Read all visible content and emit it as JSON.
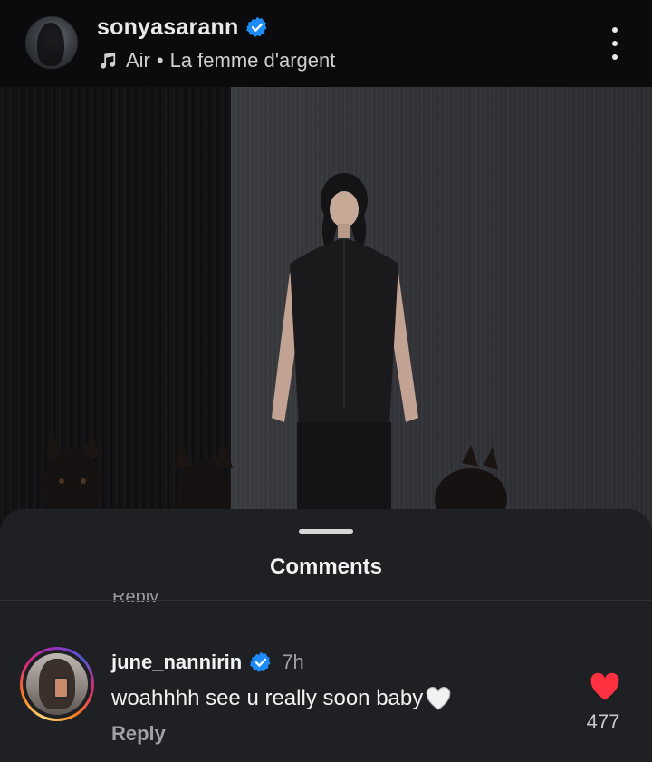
{
  "header": {
    "username": "sonyasarann",
    "music": {
      "song": "Air",
      "separator": "•",
      "artist": "La femme d'argent"
    }
  },
  "sheet": {
    "title": "Comments",
    "cut_off_text": "Reply"
  },
  "comment": {
    "username": "june_nannirin",
    "time": "7h",
    "text": "woahhhh see u really soon baby",
    "reply_label": "Reply",
    "like_count": "477"
  },
  "colors": {
    "verified_blue": "#1d8cf8",
    "like_red": "#ff3040",
    "sheet_bg": "#1f2023",
    "page_bg": "#0b0b0d"
  },
  "icons": {
    "verified": "verified-badge-icon",
    "music": "music-note-icon",
    "more": "more-vertical-icon",
    "like": "heart-icon",
    "emoji": "white-heart-emoji"
  }
}
